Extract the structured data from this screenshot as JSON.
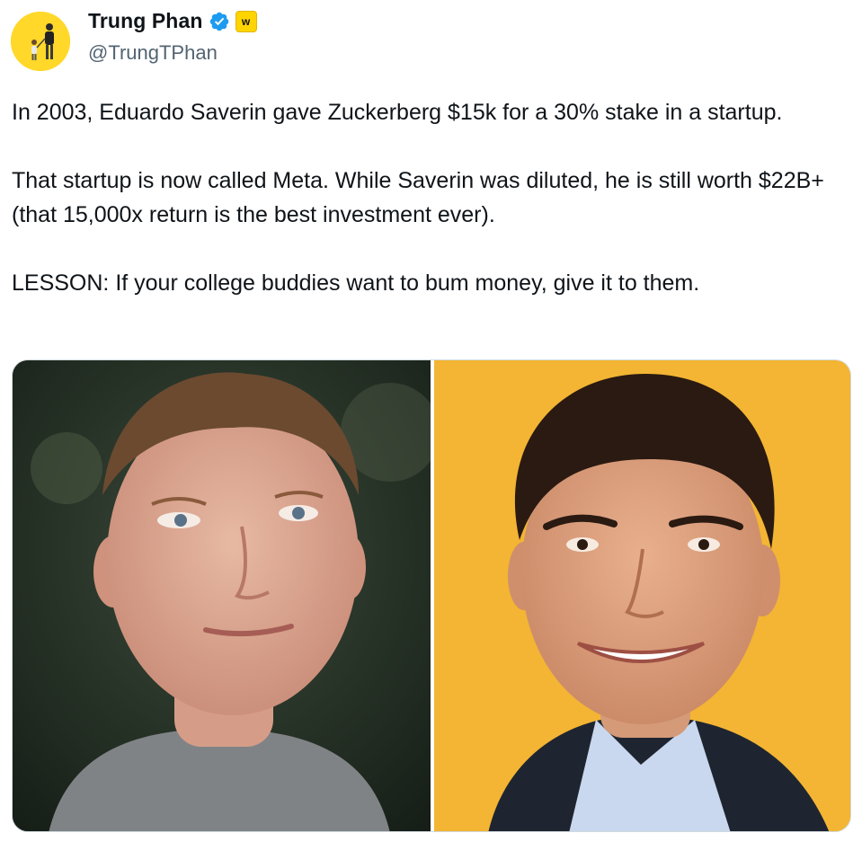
{
  "author": {
    "display_name": "Trung Phan",
    "handle": "@TrungTPhan",
    "verified_icon": "verified-badge-icon",
    "affiliate_badge_letter": "w"
  },
  "tweet": {
    "paragraphs": [
      "In 2003, Eduardo Saverin gave Zuckerberg $15k for a 30% stake in a startup.",
      "That startup is now called Meta. While Saverin was diluted, he is still worth $22B+ (that 15,000x return is the best investment ever).",
      "LESSON: If your college buddies want to bum money, give it to them."
    ]
  },
  "colors": {
    "text": "#0f1419",
    "secondary_text": "#536471",
    "verified_blue": "#1d9bf0",
    "affiliate_yellow": "#ffd400",
    "right_photo_background": "#f3b533",
    "left_photo_background": "#243326"
  }
}
